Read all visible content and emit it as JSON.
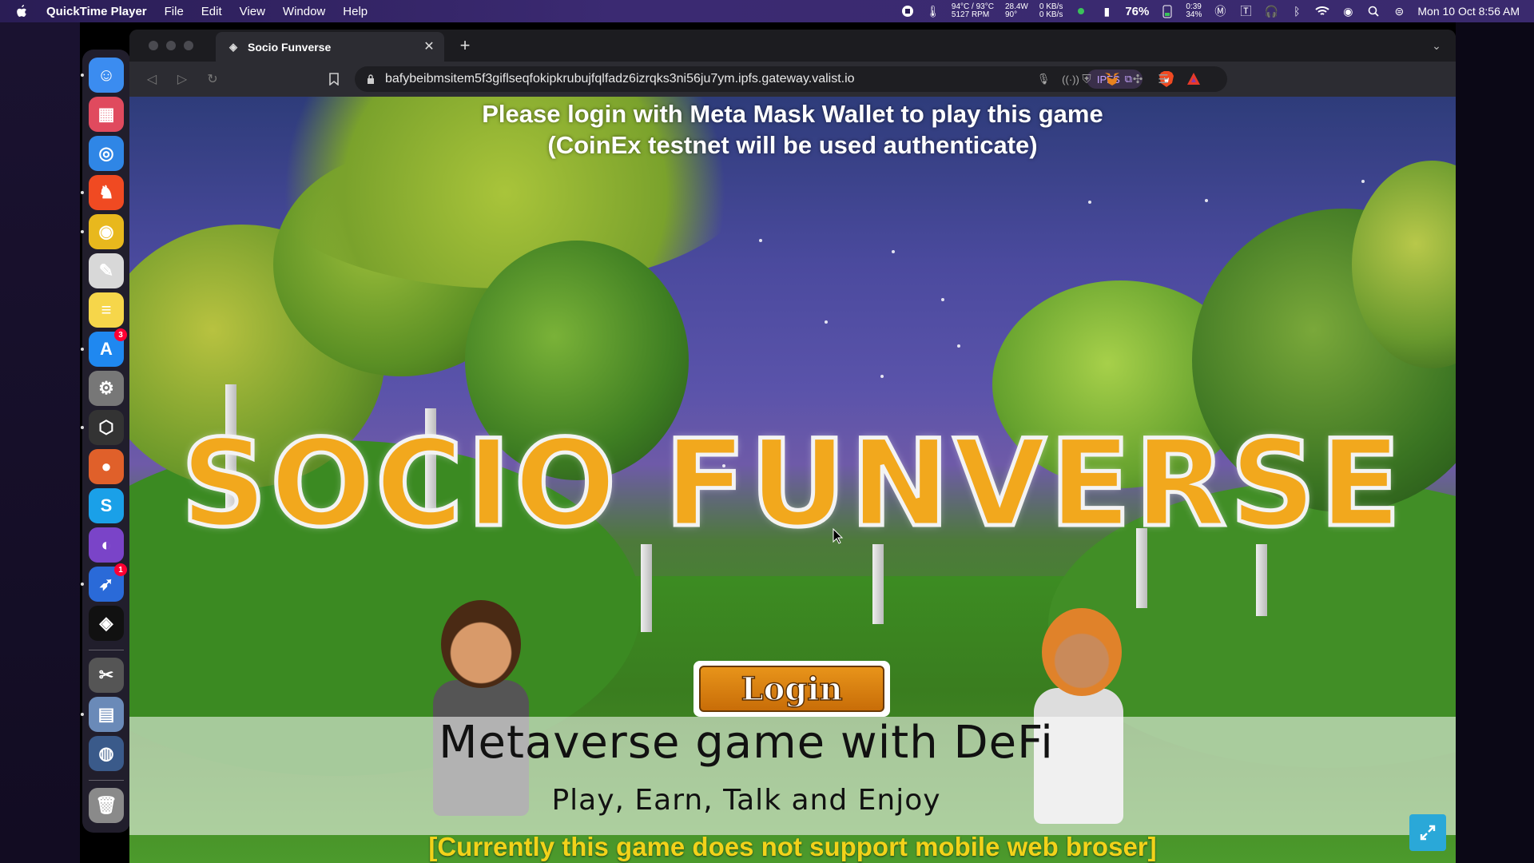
{
  "menubar": {
    "apple_icon": "apple-logo",
    "items": [
      "QuickTime Player",
      "File",
      "Edit",
      "View",
      "Window",
      "Help"
    ],
    "status": {
      "temps_line1": "94°C / 93°C",
      "temps_line2": "5127 RPM",
      "power_line1": "28.4W",
      "power_line2": "90°",
      "net_line1": "0 KB/s",
      "net_line2": "0 KB/s",
      "cpu_pct": "76%",
      "battery_line1": "0:39",
      "battery_line2": "34%",
      "datetime": "Mon 10 Oct  8:56 AM"
    }
  },
  "dock": {
    "apps": [
      {
        "name": "finder",
        "color": "#3b8cf0",
        "glyph": "☺"
      },
      {
        "name": "launchpad",
        "color": "#e04a5e",
        "glyph": "▦"
      },
      {
        "name": "safari",
        "color": "#2f86e6",
        "glyph": "◎"
      },
      {
        "name": "brave",
        "color": "#f04a22",
        "glyph": "♞"
      },
      {
        "name": "chrome",
        "color": "#e8b81d",
        "glyph": "◉"
      },
      {
        "name": "textedit",
        "color": "#d8d8d8",
        "glyph": "✎"
      },
      {
        "name": "notes",
        "color": "#f6d64a",
        "glyph": "≡"
      },
      {
        "name": "app-store",
        "color": "#1f88f0",
        "glyph": "A",
        "badge": "3"
      },
      {
        "name": "system-preferences",
        "color": "#777",
        "glyph": "⚙"
      },
      {
        "name": "unity-hub",
        "color": "#333",
        "glyph": "⬡"
      },
      {
        "name": "postman",
        "color": "#e0602a",
        "glyph": "●"
      },
      {
        "name": "skype",
        "color": "#1aa0e8",
        "glyph": "S"
      },
      {
        "name": "github-desktop",
        "color": "#7a44c8",
        "glyph": "◐"
      },
      {
        "name": "remote-desktop",
        "color": "#2a6ad8",
        "glyph": "➶",
        "badge": "1"
      },
      {
        "name": "unity",
        "color": "#111",
        "glyph": "◈"
      },
      {
        "name": "disk-utility",
        "color": "#555",
        "glyph": "✂"
      },
      {
        "name": "preview",
        "color": "#6a8ab8",
        "glyph": "▤"
      },
      {
        "name": "quicktime",
        "color": "#3a5a8a",
        "glyph": "◍"
      },
      {
        "name": "trash",
        "color": "#8a8a8a",
        "glyph": "🗑"
      }
    ]
  },
  "browser": {
    "tab_title": "Socio Funverse",
    "url": "bafybeibmsitem5f3giflseqfokipkrubujfqlfadz6izrqks3ni56ju7ym.ipfs.gateway.valist.io",
    "ipfs_label": "IPFS"
  },
  "game": {
    "login_prompt_line1": "Please login with Meta Mask Wallet to play this game",
    "login_prompt_line2": "(CoinEx testnet will be used authenticate)",
    "title": "SOCIO FUNVERSE",
    "login_label": "Login",
    "tagline": "Metaverse game with DeFi",
    "subtagline": "Play, Earn, Talk and Enjoy",
    "mobile_note": "[Currently this game does not support mobile web broser]"
  },
  "colors": {
    "title_fill": "#f2a81d",
    "login_button": "#e08a14",
    "mobile_note": "#f2d21a",
    "fullscreen_button": "#2aa8d8"
  }
}
